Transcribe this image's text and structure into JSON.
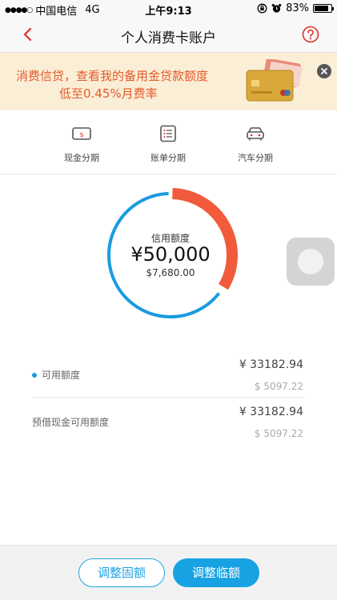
{
  "status_bar": {
    "carrier": "中国电信",
    "network": "4G",
    "time": "上午9:13",
    "battery": "83%",
    "battery_level": 0.83
  },
  "nav": {
    "title": "个人消费卡账户"
  },
  "banner": {
    "line1": "消费信贷，查看我的备用金贷款额度",
    "line2": "低至0.45%月费率"
  },
  "quick_actions": [
    {
      "label": "现金分期",
      "icon": "cash-installment-icon"
    },
    {
      "label": "账单分期",
      "icon": "bill-installment-icon"
    },
    {
      "label": "汽车分期",
      "icon": "car-installment-icon"
    }
  ],
  "credit": {
    "label": "信用额度",
    "amount": "¥50,000",
    "usd": "$7,680.00",
    "used_fraction": 0.336,
    "colors": {
      "available": "#1a9be0",
      "used": "#f25a3c"
    }
  },
  "rows": [
    {
      "label": "可用额度",
      "cny": "¥ 33182.94",
      "usd": "$ 5097.22"
    },
    {
      "label": "预借现金可用额度",
      "cny": "¥ 33182.94",
      "usd": "$ 5097.22"
    }
  ],
  "footer": {
    "fixed_label": "调整固额",
    "temp_label": "调整临额"
  }
}
